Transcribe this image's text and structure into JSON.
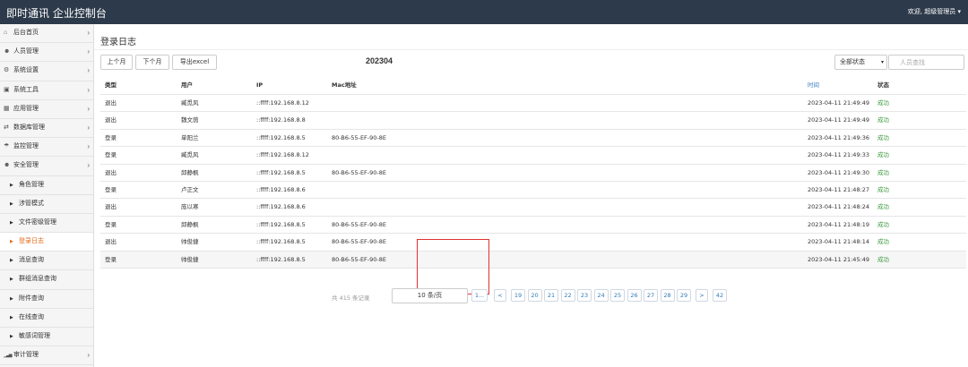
{
  "header": {
    "brand": "即时通讯 企业控制台",
    "welcome": "欢迎, 超级管理员 ▾"
  },
  "sidebar": {
    "items": [
      {
        "icon": "home-icon",
        "glyph": "⌂",
        "label": "后台首页"
      },
      {
        "icon": "users-icon",
        "glyph": "☻",
        "label": "人员管理"
      },
      {
        "icon": "gear-icon",
        "glyph": "⚙",
        "label": "系统设置"
      },
      {
        "icon": "toolbox-icon",
        "glyph": "▣",
        "label": "系统工具"
      },
      {
        "icon": "apps-icon",
        "glyph": "▦",
        "label": "应用管理"
      },
      {
        "icon": "database-icon",
        "glyph": "⇄",
        "label": "数据库管理"
      },
      {
        "icon": "monitor-icon",
        "glyph": "☂",
        "label": "监控管理"
      },
      {
        "icon": "security-icon",
        "glyph": "☻",
        "label": "安全管理"
      }
    ],
    "subitems": [
      "角色管理",
      "涉管模式",
      "文件密级管理",
      "登录日志",
      "消息查询",
      "群组消息查询",
      "附件查询",
      "在线查询",
      "敏感词管理"
    ],
    "last": {
      "icon": "audit-icon",
      "glyph": "▁▃▅",
      "label": "审计管理"
    }
  },
  "main": {
    "title": "登录日志",
    "buttons": {
      "prev": "上个月",
      "next": "下个月",
      "export": "导出excel"
    },
    "month": "202304",
    "status_select": "全部状态",
    "search_placeholder": "人员查找"
  },
  "table": {
    "headers": [
      "类型",
      "用户",
      "IP",
      "Mac地址",
      "时间",
      "状态"
    ],
    "rows": [
      [
        "退出",
        "臧觅风",
        "::ffff:192.168.8.12",
        "",
        "2023-04-11 21:49:49",
        "成功"
      ],
      [
        "退出",
        "魏文茵",
        "::ffff:192.168.8.8",
        "",
        "2023-04-11 21:49:49",
        "成功"
      ],
      [
        "登录",
        "单阳兰",
        "::ffff:192.168.8.5",
        "80-B6-55-EF-90-8E",
        "2023-04-11 21:49:36",
        "成功"
      ],
      [
        "登录",
        "臧觅风",
        "::ffff:192.168.8.12",
        "",
        "2023-04-11 21:49:33",
        "成功"
      ],
      [
        "退出",
        "邱静枫",
        "::ffff:192.168.8.5",
        "80-B6-55-EF-90-8E",
        "2023-04-11 21:49:30",
        "成功"
      ],
      [
        "登录",
        "卢正文",
        "::ffff:192.168.8.6",
        "",
        "2023-04-11 21:48:27",
        "成功"
      ],
      [
        "退出",
        "庞以寒",
        "::ffff:192.168.8.6",
        "",
        "2023-04-11 21:48:24",
        "成功"
      ],
      [
        "登录",
        "邱静枫",
        "::ffff:192.168.8.5",
        "80-B6-55-EF-90-8E",
        "2023-04-11 21:48:19",
        "成功"
      ],
      [
        "退出",
        "帅俊捷",
        "::ffff:192.168.8.5",
        "80-B6-55-EF-90-8E",
        "2023-04-11 21:48:14",
        "成功"
      ],
      [
        "登录",
        "帅俊捷",
        "::ffff:192.168.8.5",
        "80-B6-55-EF-90-8E",
        "2023-04-11 21:45:49",
        "成功"
      ]
    ]
  },
  "pager": {
    "total": "共 415 条记录",
    "page_size": "10 条/页",
    "pages": [
      "1...",
      "<",
      "19",
      "20",
      "21",
      "22",
      "23",
      "24",
      "25",
      "26",
      "27",
      "28",
      "29",
      ">",
      "42"
    ]
  },
  "colors": {
    "topbar": "#2d3a4b",
    "active": "#e06a16",
    "success": "#3c9a3c",
    "highlight": "#e03131",
    "link": "#337ab7"
  }
}
